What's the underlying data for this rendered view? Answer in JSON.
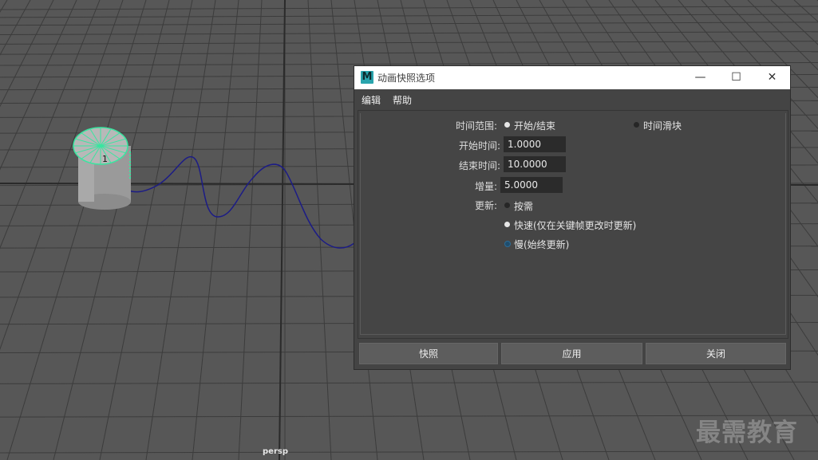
{
  "viewport": {
    "camera_label": "persp",
    "watermark": "最需教育",
    "object_number": "1",
    "mesh_color": "#39e6a0",
    "curve_color": "#1a1a7a"
  },
  "dialog": {
    "title": "动画快照选项",
    "menu": [
      "编辑",
      "帮助"
    ],
    "window_controls": {
      "minimize": "—",
      "maximize": "☐",
      "close": "✕"
    },
    "time_range": {
      "label": "时间范围:",
      "options": [
        {
          "label": "开始/结束",
          "selected": true
        },
        {
          "label": "时间滑块",
          "selected": false
        }
      ]
    },
    "start_time": {
      "label": "开始时间:",
      "value": "1.0000"
    },
    "end_time": {
      "label": "结束时间:",
      "value": "10.0000"
    },
    "increment": {
      "label": "增量:",
      "value": "5.0000"
    },
    "update": {
      "label": "更新:",
      "options": [
        {
          "label": "按需",
          "selected": false
        },
        {
          "label": "快速(仅在关键帧更改时更新)",
          "selected": true
        },
        {
          "label": "慢(始终更新)",
          "selected": false
        }
      ]
    },
    "buttons": {
      "snapshot": "快照",
      "apply": "应用",
      "close": "关闭"
    }
  }
}
